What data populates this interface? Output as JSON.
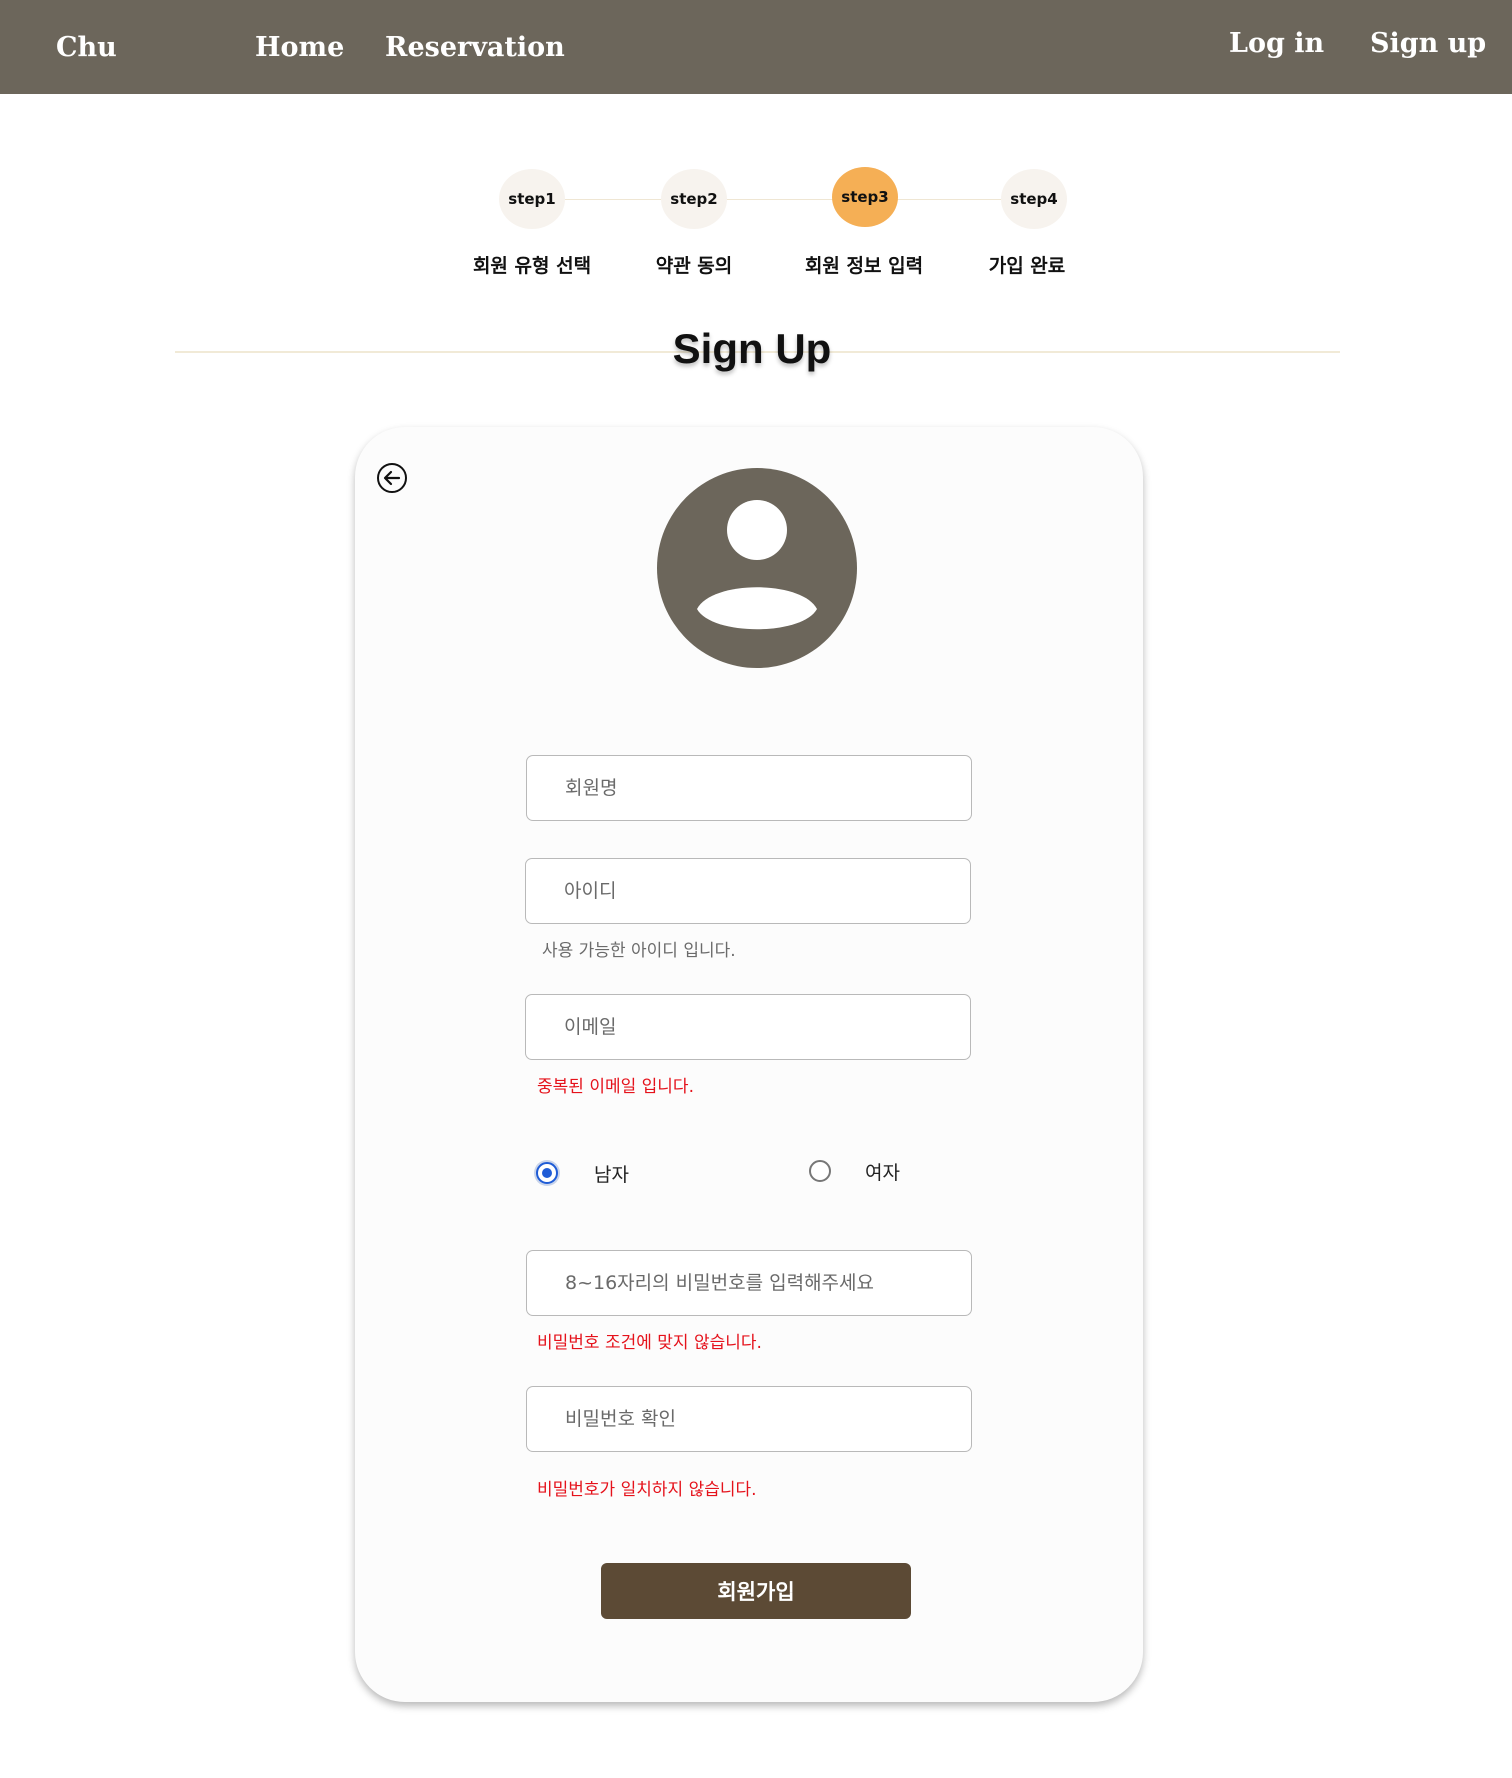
{
  "nav": {
    "brand": "Chu",
    "home": "Home",
    "reservation": "Reservation",
    "login": "Log in",
    "signup": "Sign up"
  },
  "steps": [
    {
      "circle": "step1",
      "label": "회원 유형 선택",
      "active": false
    },
    {
      "circle": "step2",
      "label": "약관 동의",
      "active": false
    },
    {
      "circle": "step3",
      "label": "회원 정보 입력",
      "active": true
    },
    {
      "circle": "step4",
      "label": "가입 완료",
      "active": false
    }
  ],
  "page_title": "Sign Up",
  "form": {
    "name_placeholder": "회원명",
    "id_placeholder": "아이디",
    "id_message": "사용 가능한 아이디 입니다.",
    "email_placeholder": "이메일",
    "email_message": "중복된 이메일 입니다.",
    "gender": {
      "male_label": "남자",
      "female_label": "여자",
      "selected": "남자"
    },
    "password_placeholder": "8~16자리의 비밀번호를 입력해주세요",
    "password_message": "비밀번호 조건에 맞지 않습니다.",
    "confirm_placeholder": "비밀번호 확인",
    "confirm_message": "비밀번호가 일치하지 않습니다.",
    "submit_label": "회원가입"
  },
  "icons": {
    "back": "back-arrow-icon",
    "avatar": "user-avatar-icon"
  },
  "colors": {
    "nav_bg": "#6c665b",
    "active_step": "#f5af55",
    "error": "#e5121b",
    "submit_bg": "#5c4a35",
    "avatar": "#6c665b"
  }
}
